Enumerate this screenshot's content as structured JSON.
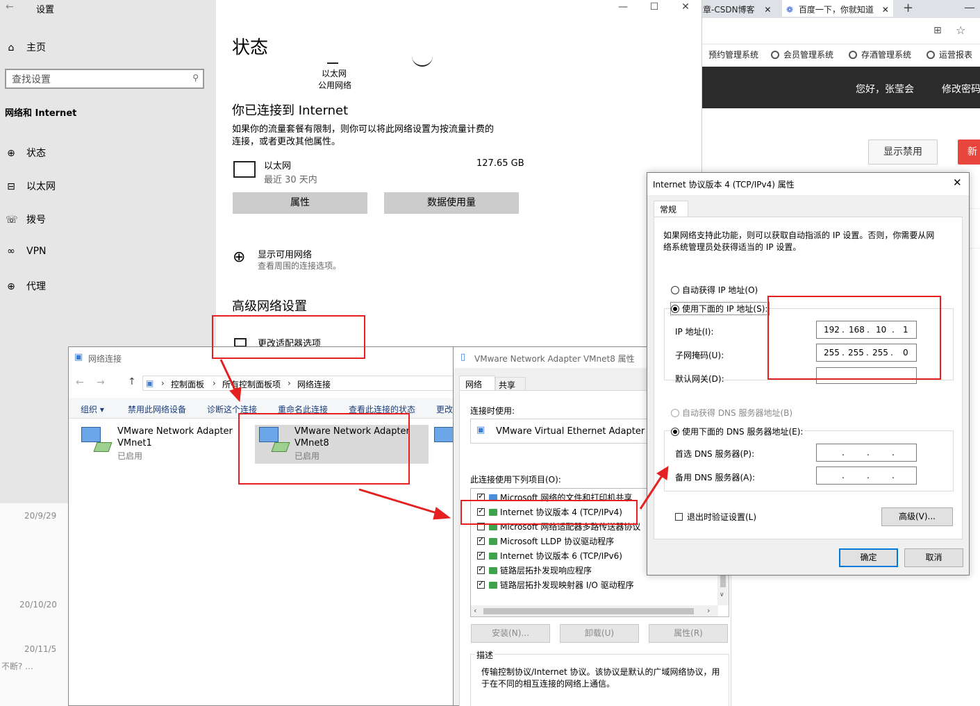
{
  "browser": {
    "tabs": [
      "章-CSDN博客",
      "百度一下，你就知道"
    ],
    "bookmarks": [
      "预约管理系统",
      "会员管理系统",
      "存酒管理系统",
      "运营报表"
    ],
    "greeting": "您好，张莹会",
    "change_password": "修改密码",
    "show_disabled_button": "显示禁用",
    "new_button": "新"
  },
  "settings": {
    "window_title": "设置",
    "home": "主页",
    "search_placeholder": "查找设置",
    "category": "网络和 Internet",
    "nav": [
      "状态",
      "以太网",
      "拨号",
      "VPN",
      "代理"
    ],
    "page_title": "状态",
    "ethernet_label": "以太网",
    "public_network": "公用网络",
    "connected_heading": "你已连接到 Internet",
    "connected_desc_1": "如果你的流量套餐有限制，则你可以将此网络设置为按流量计费的",
    "connected_desc_2": "连接，或者更改其他属性。",
    "conn_name": "以太网",
    "conn_period": "最近 30 天内",
    "conn_usage": "127.65 GB",
    "properties_button": "属性",
    "data_usage_button": "数据使用量",
    "show_networks": "显示可用网络",
    "show_networks_desc": "查看周围的连接选项。",
    "advanced_heading": "高级网络设置",
    "change_adapter": "更改适配器选项"
  },
  "background_dates": [
    "20/9/29",
    "20/10/20",
    "20/11/5"
  ],
  "background_text": "不断? ...",
  "netconn": {
    "title": "网络连接",
    "breadcrumb": [
      "控制面板",
      "所有控制面板项",
      "网络连接"
    ],
    "commands": [
      "组织 ▾",
      "禁用此网络设备",
      "诊断这个连接",
      "重命名此连接",
      "查看此连接的状态",
      "更改"
    ],
    "adapters": [
      {
        "name1": "VMware Network Adapter",
        "name2": "VMnet1",
        "status": "已启用"
      },
      {
        "name1": "VMware Network Adapter",
        "name2": "VMnet8",
        "status": "已启用"
      }
    ]
  },
  "vmnet8_props": {
    "title": "VMware Network Adapter VMnet8 属性",
    "tabs": [
      "网络",
      "共享"
    ],
    "connect_using_label": "连接时使用:",
    "adapter": "VMware Virtual Ethernet Adapter for",
    "items_label": "此连接使用下列项目(O):",
    "items": [
      {
        "label": "Microsoft 网络的文件和打印机共享",
        "checked": true
      },
      {
        "label": "Internet 协议版本 4 (TCP/IPv4)",
        "checked": true
      },
      {
        "label": "Microsoft 网络适配器多路传送器协议",
        "checked": false
      },
      {
        "label": "Microsoft LLDP 协议驱动程序",
        "checked": true
      },
      {
        "label": "Internet 协议版本 6 (TCP/IPv6)",
        "checked": true
      },
      {
        "label": "链路层拓扑发现响应程序",
        "checked": true
      },
      {
        "label": "链路层拓扑发现映射器 I/O 驱动程序",
        "checked": true
      }
    ],
    "install_button": "安装(N)...",
    "uninstall_button": "卸载(U)",
    "properties_button": "属性(R)",
    "desc_label": "描述",
    "desc_text_1": "传输控制协议/Internet 协议。该协议是默认的广域网络协议，用",
    "desc_text_2": "于在不同的相互连接的网络上通信。"
  },
  "ipv4": {
    "title": "Internet 协议版本 4 (TCP/IPv4) 属性",
    "tab": "常规",
    "intro_1": "如果网络支持此功能，则可以获取自动指派的 IP 设置。否则，你需要从网",
    "intro_2": "络系统管理员处获得适当的 IP 设置。",
    "auto_ip": "自动获得 IP 地址(O)",
    "manual_ip": "使用下面的 IP 地址(S):",
    "ip_label": "IP 地址(I):",
    "ip_value": [
      "192",
      "168",
      "10",
      "1"
    ],
    "mask_label": "子网掩码(U):",
    "mask_value": [
      "255",
      "255",
      "255",
      "0"
    ],
    "gateway_label": "默认网关(D):",
    "auto_dns": "自动获得 DNS 服务器地址(B)",
    "manual_dns": "使用下面的 DNS 服务器地址(E):",
    "pref_dns_label": "首选 DNS 服务器(P):",
    "alt_dns_label": "备用 DNS 服务器(A):",
    "validate_label": "退出时验证设置(L)",
    "advanced_button": "高级(V)...",
    "ok_button": "确定",
    "cancel_button": "取消"
  },
  "colors": {
    "annotation": "#e52020",
    "settings_bg": "#e6e6e6",
    "dialog_bg": "#f0f0f0"
  }
}
